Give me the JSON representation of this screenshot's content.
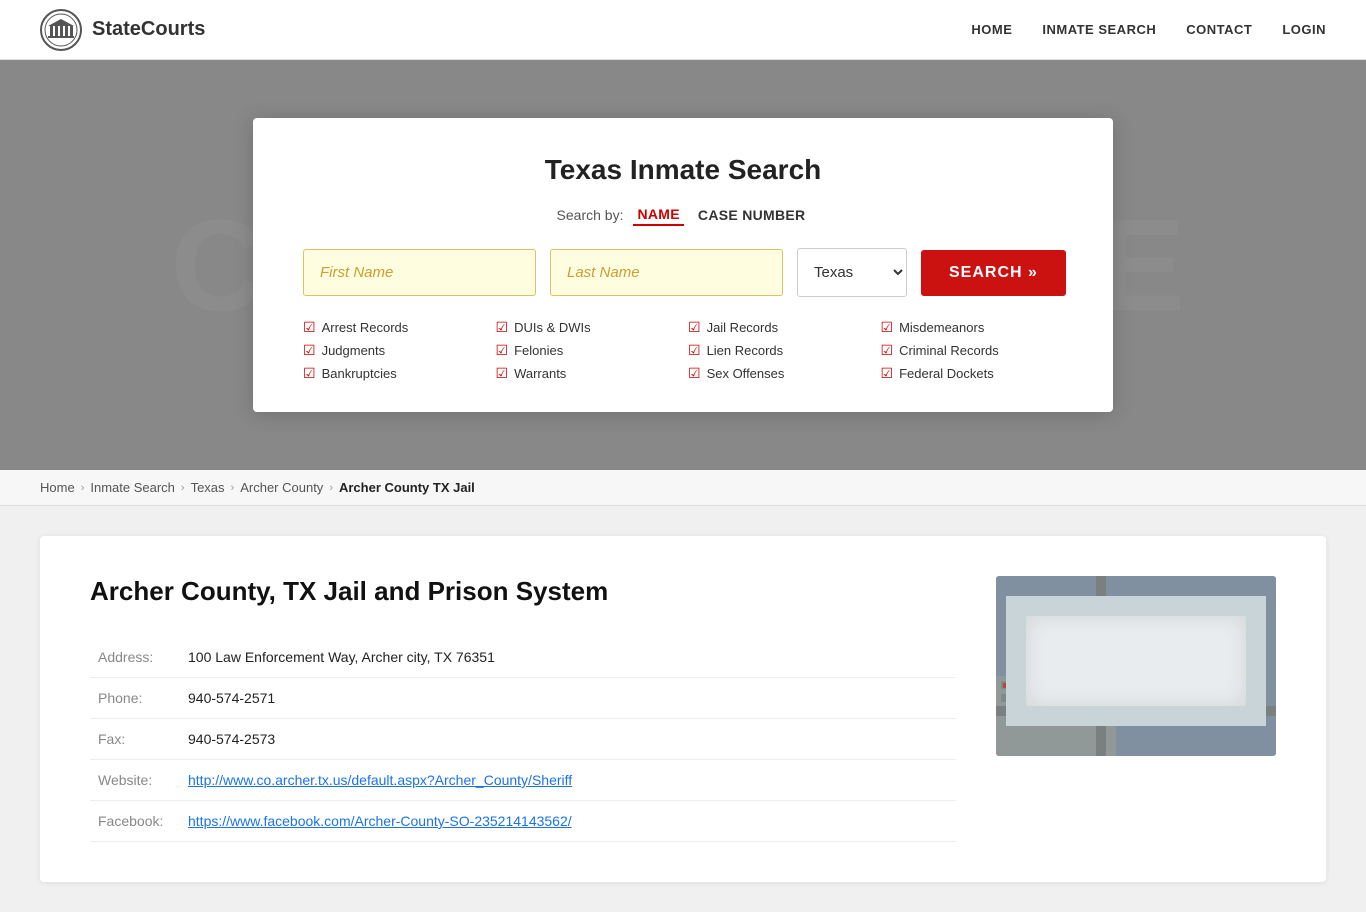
{
  "header": {
    "logo_text": "StateCourts",
    "nav": {
      "home": "HOME",
      "inmate_search": "INMATE SEARCH",
      "contact": "CONTACT",
      "login": "LOGIN"
    }
  },
  "hero": {
    "bg_text": "COURTHOUSE"
  },
  "search_card": {
    "title": "Texas Inmate Search",
    "search_by_label": "Search by:",
    "tab_name": "NAME",
    "tab_case": "CASE NUMBER",
    "first_name_placeholder": "First Name",
    "last_name_placeholder": "Last Name",
    "state_value": "Texas",
    "search_button_label": "SEARCH »",
    "checkboxes": [
      "Arrest Records",
      "DUIs & DWIs",
      "Jail Records",
      "Misdemeanors",
      "Judgments",
      "Felonies",
      "Lien Records",
      "Criminal Records",
      "Bankruptcies",
      "Warrants",
      "Sex Offenses",
      "Federal Dockets"
    ]
  },
  "breadcrumb": {
    "items": [
      {
        "label": "Home",
        "active": false
      },
      {
        "label": "Inmate Search",
        "active": false
      },
      {
        "label": "Texas",
        "active": false
      },
      {
        "label": "Archer County",
        "active": false
      },
      {
        "label": "Archer County TX Jail",
        "active": true
      }
    ]
  },
  "jail_info": {
    "title": "Archer County, TX Jail and Prison System",
    "address_label": "Address:",
    "address_value": "100 Law Enforcement Way, Archer city, TX 76351",
    "phone_label": "Phone:",
    "phone_value": "940-574-2571",
    "fax_label": "Fax:",
    "fax_value": "940-574-2573",
    "website_label": "Website:",
    "website_value": "http://www.co.archer.tx.us/default.aspx?Archer_County/Sheriff",
    "facebook_label": "Facebook:",
    "facebook_value": "https://www.facebook.com/Archer-County-SO-235214143562/"
  }
}
